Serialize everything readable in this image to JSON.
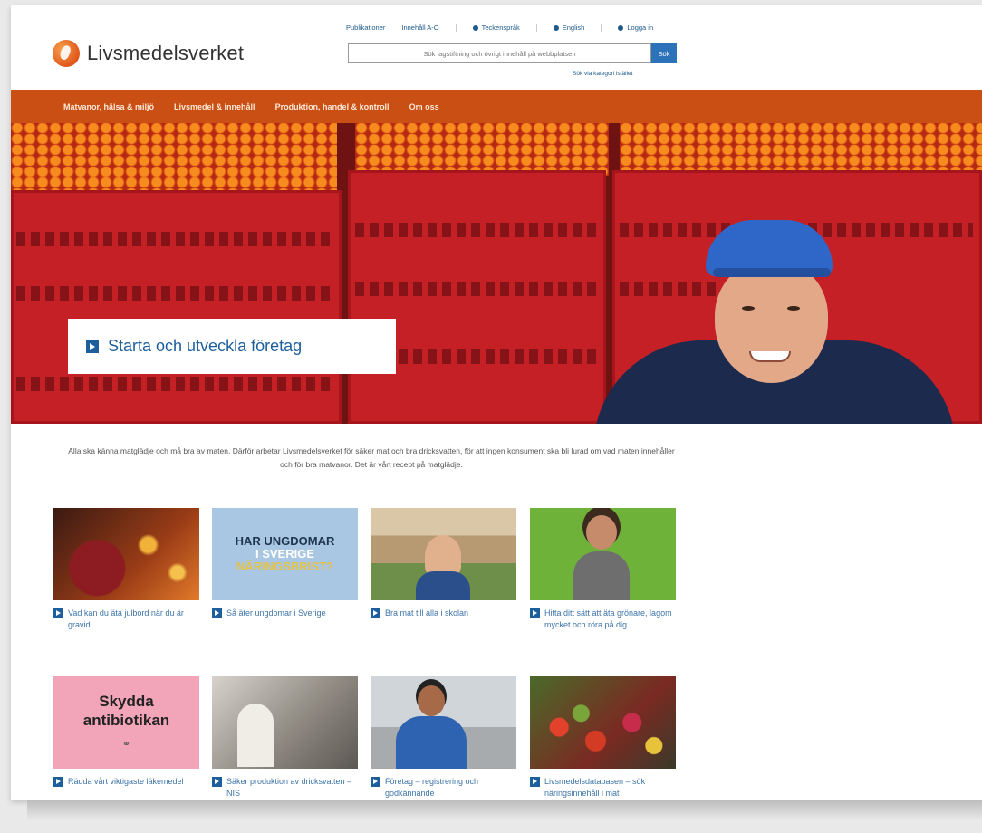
{
  "header": {
    "logo_text": "Livsmedelsverket",
    "top_links": [
      "Publikationer",
      "Innehåll A-Ö",
      "Teckenspråk",
      "English",
      "Logga in"
    ],
    "search_placeholder": "Sök lagstiftning och övrigt innehåll på webbplatsen",
    "search_button": "Sök",
    "category_link": "Sök via kategori istället"
  },
  "nav": {
    "items": [
      "Matvanor, hälsa & miljö",
      "Livsmedel & innehåll",
      "Produktion, handel & kontroll",
      "Om oss"
    ]
  },
  "hero": {
    "cta": "Starta och utveckla företag"
  },
  "intro": "Alla ska känna matglädje och må bra av maten. Därför arbetar Livsmedelsverket för säker mat och bra dricksvatten, för att ingen konsument ska bli lurad om vad maten innehåller och för bra matvanor. Det är vårt recept på matglädje.",
  "cards": [
    {
      "caption": "Vad kan du äta julbord när du är gravid"
    },
    {
      "caption": "Så äter ungdomar i Sverige",
      "thumb_lines": [
        "HAR UNGDOMAR",
        "I SVERIGE",
        "NÄRINGSBRIST?"
      ]
    },
    {
      "caption": "Bra mat till alla i skolan"
    },
    {
      "caption": "Hitta ditt sätt att äta grönare, lagom mycket och röra på dig"
    },
    {
      "caption": "Rädda vårt viktigaste läkemedel",
      "thumb_lines": [
        "Skydda",
        "antibiotikan"
      ]
    },
    {
      "caption": "Säker produktion av dricksvatten – NIS"
    },
    {
      "caption": "Företag – registrering och godkännande"
    },
    {
      "caption": "Livsmedelsdatabasen – sök näringsinnehåll i mat"
    }
  ],
  "colors": {
    "nav_orange": "#c94f14",
    "link_blue": "#1d5f9c",
    "search_button": "#2b72b8"
  }
}
